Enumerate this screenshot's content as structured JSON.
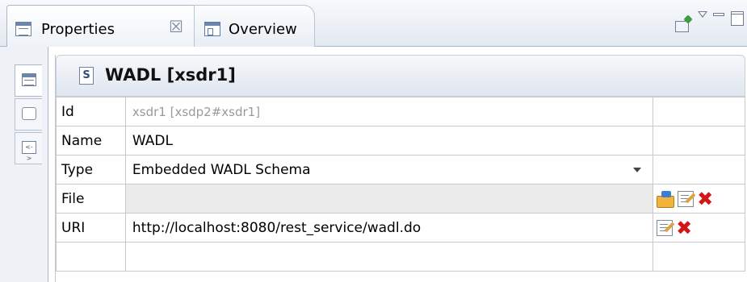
{
  "tabs": {
    "properties_label": "Properties",
    "properties_close": "☒",
    "overview_label": "Overview"
  },
  "header": {
    "title": "WADL [xsdr1]",
    "icon_letter": "S"
  },
  "rows": [
    {
      "label": "Id",
      "value": "xsdr1  [xsdp2#xsdr1]"
    },
    {
      "label": "Name",
      "value": "WADL"
    },
    {
      "label": "Type",
      "value": "Embedded WADL Schema"
    },
    {
      "label": "File",
      "value": ""
    },
    {
      "label": "URI",
      "value": "http://localhost:8080/rest_service/wadl.do"
    }
  ],
  "icons": {
    "view_tab_icons": [
      "properties-icon",
      "overview-icon"
    ],
    "toolbar": [
      "pin-icon",
      "view-menu-icon",
      "minimize-icon",
      "maximize-icon"
    ],
    "side_tabs": [
      "table-icon",
      "comment-icon",
      "source-icon"
    ],
    "row_actions": [
      "browse-folder-icon",
      "edit-icon",
      "delete-icon"
    ]
  },
  "colors": {
    "delete": "#d01818",
    "readonly_text": "#9a9a9a",
    "header_gradient_end": "#dfe6ef"
  }
}
